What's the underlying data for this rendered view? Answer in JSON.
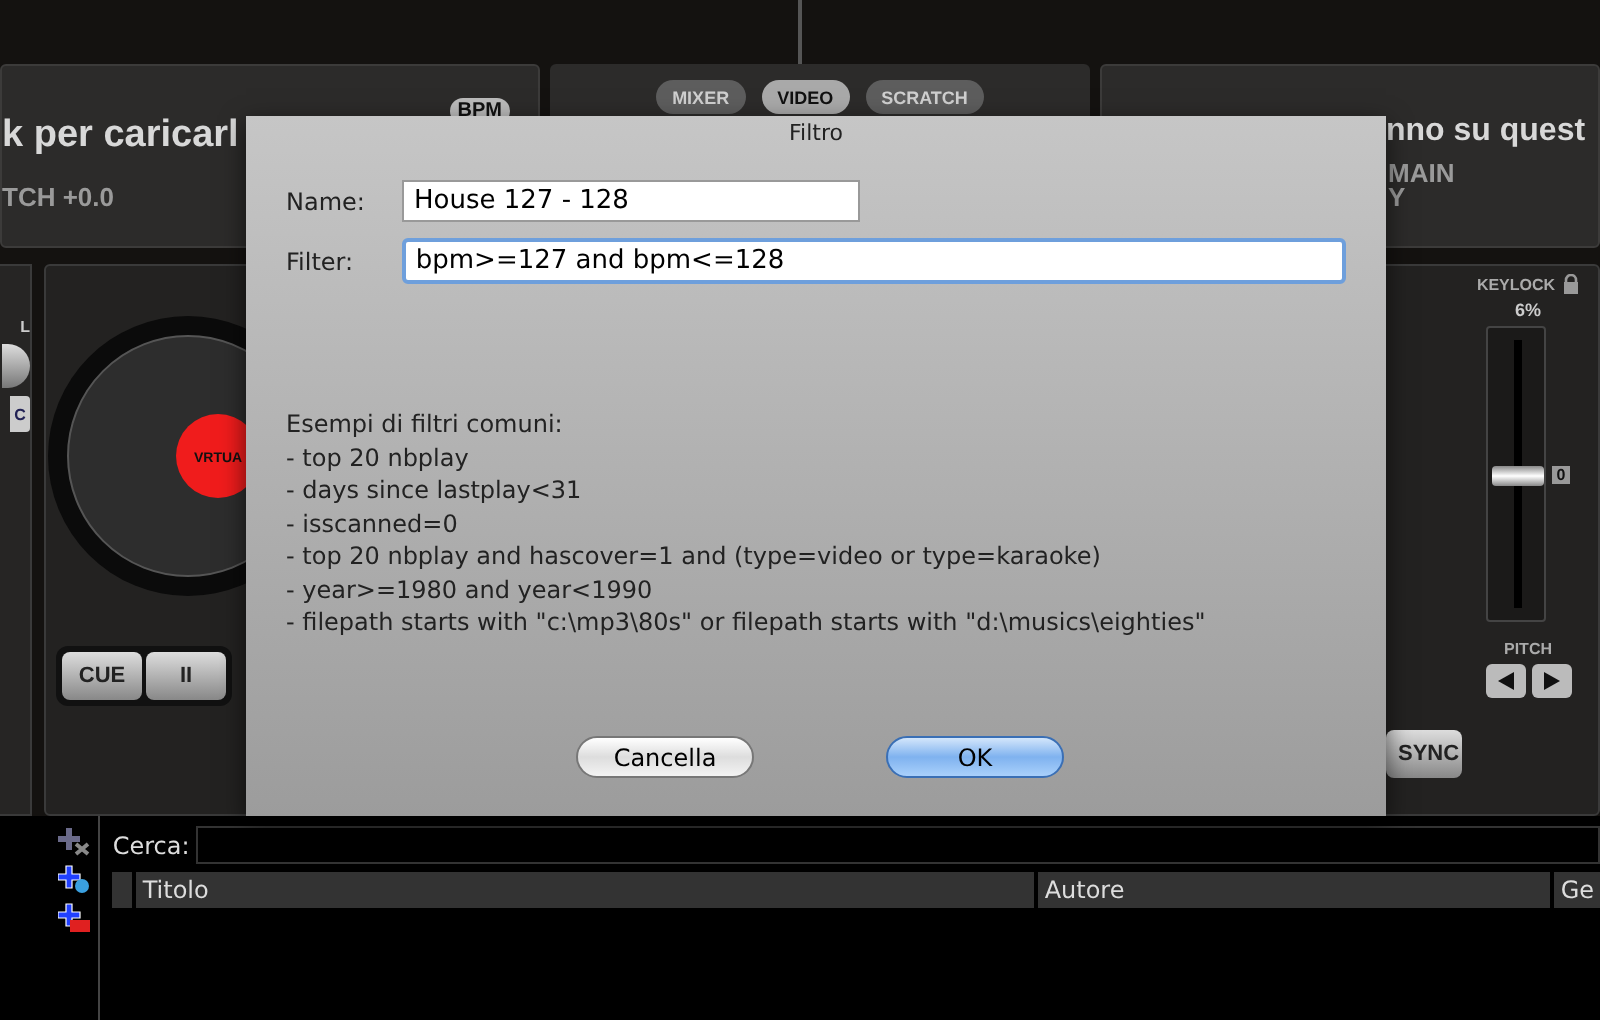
{
  "left_deck": {
    "title": "k per caricarl",
    "pitch": "TCH +0.0",
    "bpm_button": "BPM",
    "strip_label": "L",
    "strip_button": "C",
    "platter_label": "VRTUA",
    "buttons": [
      "CUE",
      "II"
    ]
  },
  "center_panel": {
    "tabs": [
      {
        "label": "MIXER",
        "selected": false
      },
      {
        "label": "VIDEO",
        "selected": true
      },
      {
        "label": "SCRATCH",
        "selected": false
      }
    ]
  },
  "right_deck": {
    "title": "nno su quest",
    "info_lines": [
      "MAIN",
      "Y"
    ],
    "keylock": "KEYLOCK",
    "keylock_value": "6%",
    "pitch_zero": "0",
    "pitch_label": "PITCH",
    "pitch_slider": {
      "level": 0.5
    },
    "sync": "SYNC"
  },
  "browser": {
    "search_label": "Cerca:",
    "columns": [
      "Titolo",
      "Autore",
      "Ge"
    ]
  },
  "dialog": {
    "title": "Filtro",
    "fields": [
      {
        "label": "Name:",
        "value": "House 127 - 128",
        "focused": false
      },
      {
        "label": "Filter:",
        "value": "bpm>=127 and bpm<=128",
        "focused": true
      }
    ],
    "examples_heading": "Esempi di filtri comuni:",
    "examples": [
      "- top 20 nbplay",
      "- days since lastplay<31",
      "- isscanned=0",
      "- top 20 nbplay and hascover=1 and (type=video or type=karaoke)",
      "- year>=1980 and year<1990",
      "- filepath starts with \"c:\\mp3\\80s\" or filepath starts with \"d:\\musics\\eighties\""
    ],
    "buttons": [
      {
        "label": "Cancella",
        "default": false
      },
      {
        "label": "OK",
        "default": true
      }
    ]
  }
}
